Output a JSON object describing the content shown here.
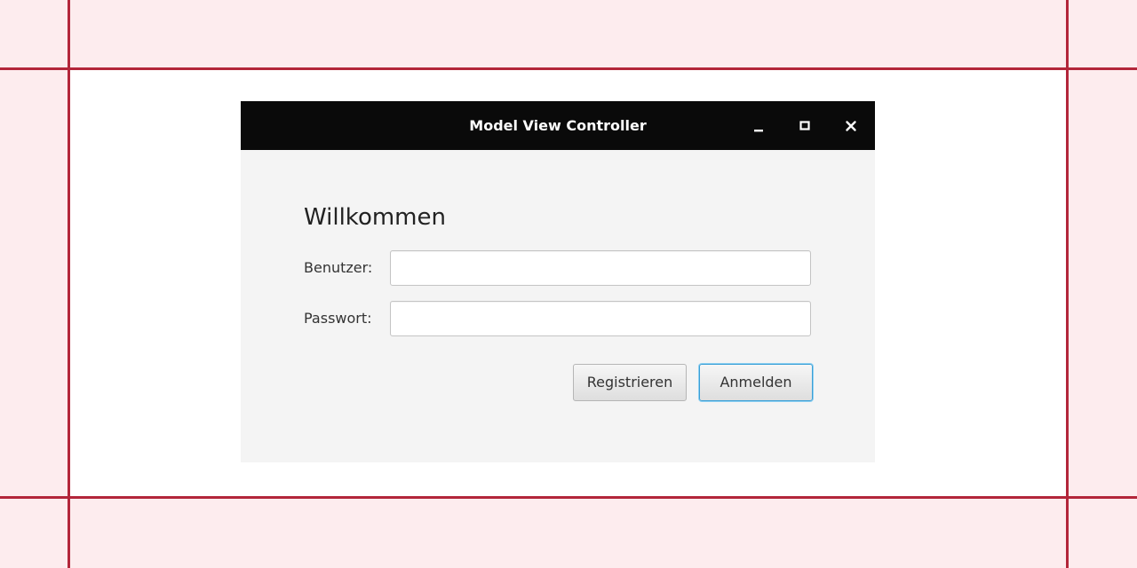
{
  "window": {
    "title": "Model View Controller",
    "controls": {
      "minimize_icon": "minimize-icon",
      "maximize_icon": "maximize-icon",
      "close_icon": "close-icon"
    }
  },
  "form": {
    "heading": "Willkommen",
    "user_label": "Benutzer:",
    "user_value": "",
    "password_label": "Passwort:",
    "password_value": "",
    "register_label": "Registrieren",
    "login_label": "Anmelden"
  },
  "colors": {
    "titlebar": "#0a0a0a",
    "accent_focus": "#3a9fd6",
    "guide_lines": "#b3263a",
    "outer_background": "#fdecee"
  }
}
